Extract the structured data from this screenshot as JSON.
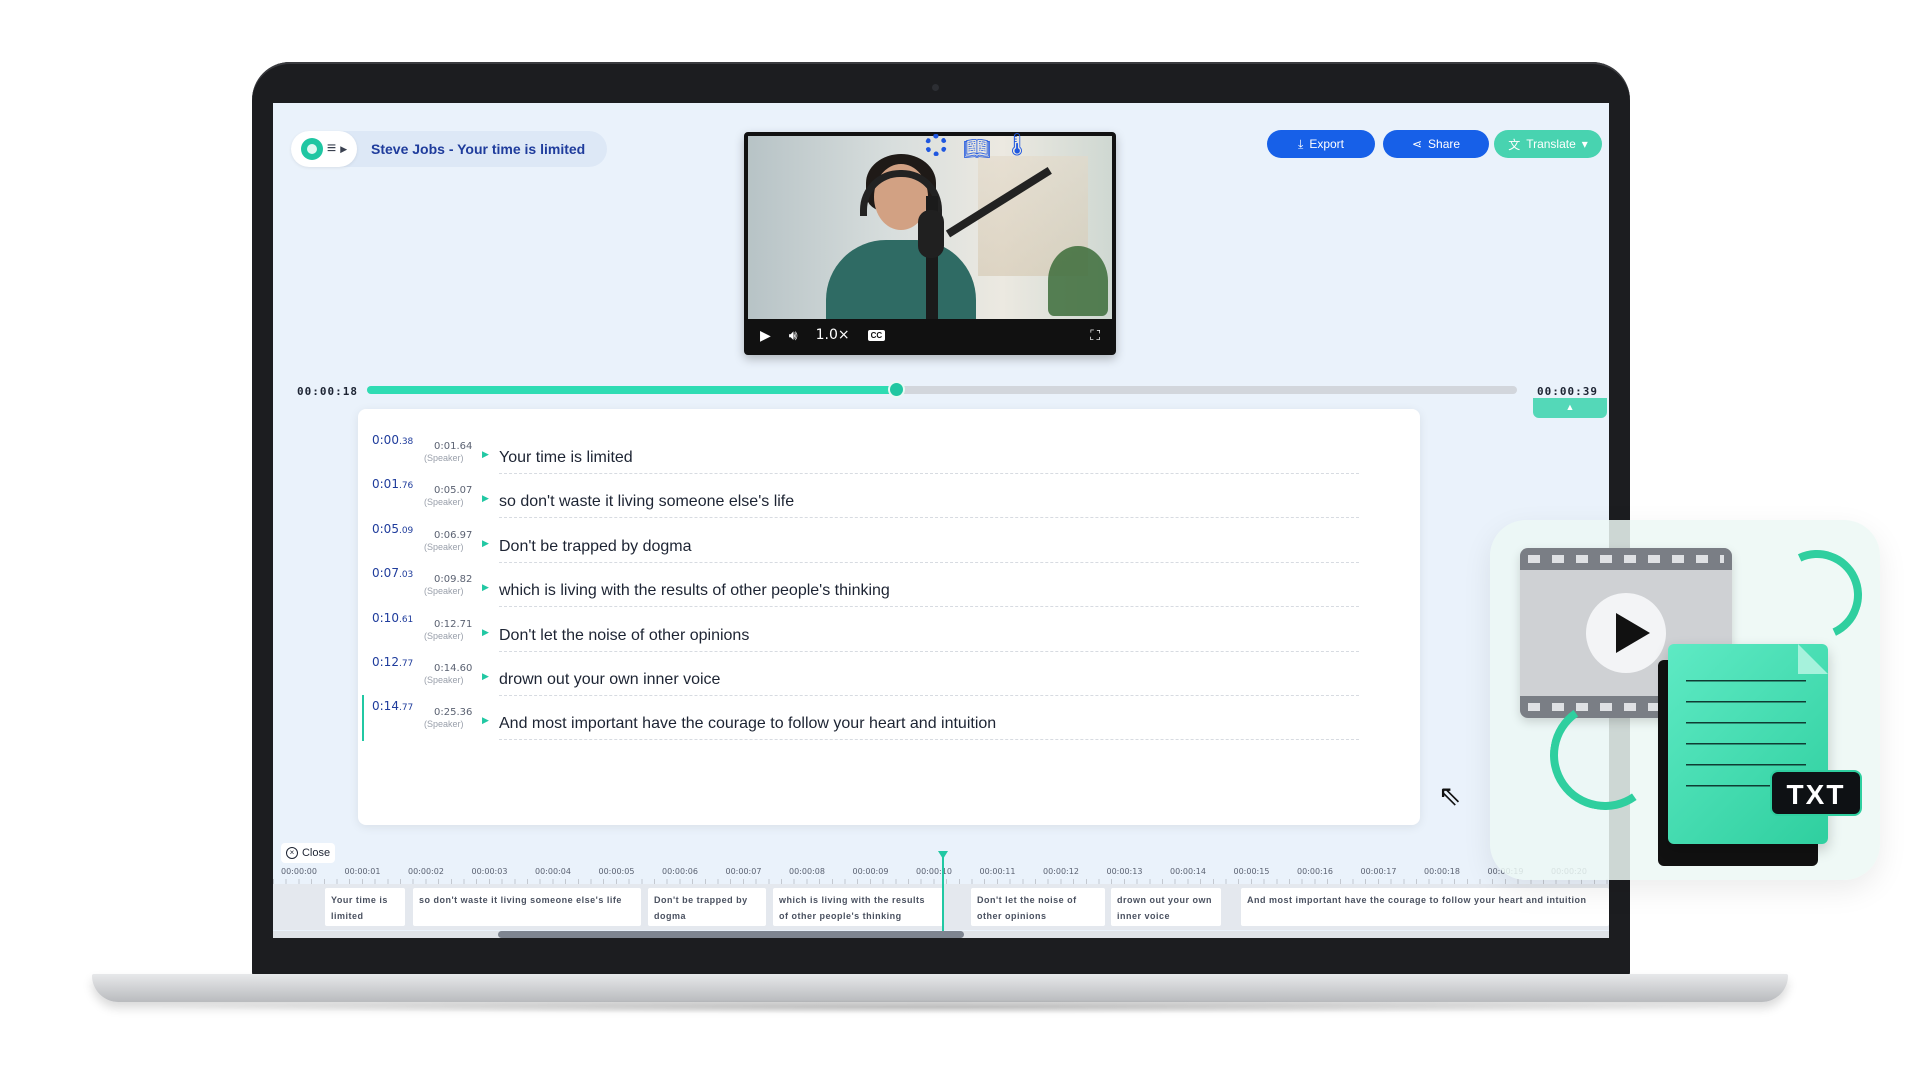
{
  "header": {
    "title": "Steve Jobs - Your time is limited"
  },
  "player": {
    "speed": "1.0×",
    "cc_label": "CC"
  },
  "toolbar": {
    "export_label": "Export",
    "share_label": "Share",
    "translate_label": "Translate"
  },
  "playback": {
    "current_time": "00:00:18",
    "total_time": "00:00:39",
    "progress_fraction": 0.46
  },
  "segments": [
    {
      "start_main": "0:00",
      "start_frac": ".38",
      "end": "0:01.64",
      "speaker": "(Speaker)",
      "text": "Your time is limited"
    },
    {
      "start_main": "0:01",
      "start_frac": ".76",
      "end": "0:05.07",
      "speaker": "(Speaker)",
      "text": "so don't waste it living someone else's life"
    },
    {
      "start_main": "0:05",
      "start_frac": ".09",
      "end": "0:06.97",
      "speaker": "(Speaker)",
      "text": "Don't be trapped by dogma"
    },
    {
      "start_main": "0:07",
      "start_frac": ".03",
      "end": "0:09.82",
      "speaker": "(Speaker)",
      "text": "which is living with the results of other people's thinking"
    },
    {
      "start_main": "0:10",
      "start_frac": ".61",
      "end": "0:12.71",
      "speaker": "(Speaker)",
      "text": "Don't let the noise of other opinions"
    },
    {
      "start_main": "0:12",
      "start_frac": ".77",
      "end": "0:14.60",
      "speaker": "(Speaker)",
      "text": "drown out your own inner voice"
    },
    {
      "start_main": "0:14",
      "start_frac": ".77",
      "end": "0:25.36",
      "speaker": "(Speaker)",
      "text": "And most important have the courage to follow your heart and intuition"
    }
  ],
  "timeline": {
    "close_label": "Close",
    "ticks": [
      "00:00:00",
      "00:00:01",
      "00:00:02",
      "00:00:03",
      "00:00:04",
      "00:00:05",
      "00:00:06",
      "00:00:07",
      "00:00:08",
      "00:00:09",
      "00:00:10",
      "00:00:11",
      "00:00:12",
      "00:00:13",
      "00:00:14",
      "00:00:15",
      "00:00:16",
      "00:00:17",
      "00:00:18",
      "00:00:19",
      "00:00:20"
    ],
    "captions": [
      "Your time is limited",
      "so don't waste it living someone else's life",
      "Don't be trapped by dogma",
      "which is living with the results of other people's thinking",
      "Don't let the noise of other opinions",
      "drown out your own inner voice",
      "And most important have the courage to follow your heart and intuition"
    ]
  },
  "illustration": {
    "badge": "TXT"
  },
  "colors": {
    "accent": "#21c8a3",
    "primary": "#1760e8",
    "title": "#1f3c9c"
  },
  "icons": [
    "logo-icon",
    "menu-icon",
    "play-icon",
    "volume-icon",
    "cc-icon",
    "fullscreen-icon",
    "gear-icon",
    "book-icon",
    "thermometer-icon",
    "download-icon",
    "share-icon",
    "translate-icon",
    "cursor-icon",
    "close-icon"
  ]
}
